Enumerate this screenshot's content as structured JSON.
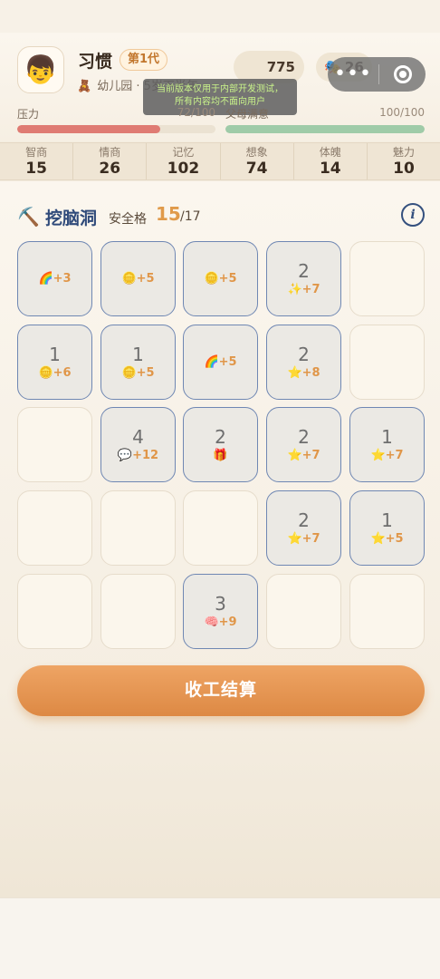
{
  "header": {
    "avatar_icon": "👦",
    "name": "习惯",
    "generation_badge": "第1代",
    "stage_icon": "🧸",
    "stage_text": "幼儿园 · 5岁下半年",
    "coin_value": "775",
    "mask_icon": "🎭",
    "mask_value": "26",
    "pressure_label": "压力",
    "pressure_value": "72/100",
    "pressure_fraction": 0.72,
    "satisfaction_label": "父母满意",
    "satisfaction_value": "100/100",
    "satisfaction_fraction": 1.0,
    "colors": {
      "pressure": "#df7b73",
      "satisfaction": "#9fcba8"
    }
  },
  "system": {
    "toast_line1": "当前版本仅用于内部开发测试，",
    "toast_line2": "所有内容均不面向用户",
    "more_icon": "•••"
  },
  "stats": [
    {
      "label": "智商",
      "value": "15"
    },
    {
      "label": "情商",
      "value": "26"
    },
    {
      "label": "记忆",
      "value": "102"
    },
    {
      "label": "想象",
      "value": "74"
    },
    {
      "label": "体魄",
      "value": "14"
    },
    {
      "label": "魅力",
      "value": "10"
    }
  ],
  "game": {
    "pick_icon": "⛏️",
    "title": "挖脑洞",
    "safe_label": "安全格",
    "safe_count": "15",
    "safe_total": "/17",
    "info_icon": "i",
    "settle_label": "收工结算",
    "grid": [
      [
        {
          "state": "dug",
          "num": "",
          "reward": "🌈+3"
        },
        {
          "state": "dug",
          "num": "",
          "reward": "🪙+5"
        },
        {
          "state": "dug",
          "num": "",
          "reward": "🪙+5"
        },
        {
          "state": "dug",
          "num": "2",
          "reward": "✨+7"
        },
        {
          "state": "empty",
          "num": "",
          "reward": ""
        }
      ],
      [
        {
          "state": "dug",
          "num": "1",
          "reward": "🪙+6"
        },
        {
          "state": "dug",
          "num": "1",
          "reward": "🪙+5"
        },
        {
          "state": "dug",
          "num": "",
          "reward": "🌈+5"
        },
        {
          "state": "dug",
          "num": "2",
          "reward": "⭐+8"
        },
        {
          "state": "empty",
          "num": "",
          "reward": ""
        }
      ],
      [
        {
          "state": "empty",
          "num": "",
          "reward": ""
        },
        {
          "state": "dug",
          "num": "4",
          "reward": "💬+12"
        },
        {
          "state": "dug",
          "num": "2",
          "reward": "🎁"
        },
        {
          "state": "dug",
          "num": "2",
          "reward": "⭐+7"
        },
        {
          "state": "dug",
          "num": "1",
          "reward": "⭐+7"
        }
      ],
      [
        {
          "state": "empty",
          "num": "",
          "reward": ""
        },
        {
          "state": "empty",
          "num": "",
          "reward": ""
        },
        {
          "state": "empty",
          "num": "",
          "reward": ""
        },
        {
          "state": "dug",
          "num": "2",
          "reward": "⭐+7"
        },
        {
          "state": "dug",
          "num": "1",
          "reward": "⭐+5"
        }
      ],
      [
        {
          "state": "empty",
          "num": "",
          "reward": ""
        },
        {
          "state": "empty",
          "num": "",
          "reward": ""
        },
        {
          "state": "dug",
          "num": "3",
          "reward": "🧠+9"
        },
        {
          "state": "empty",
          "num": "",
          "reward": ""
        },
        {
          "state": "empty",
          "num": "",
          "reward": ""
        }
      ]
    ]
  }
}
